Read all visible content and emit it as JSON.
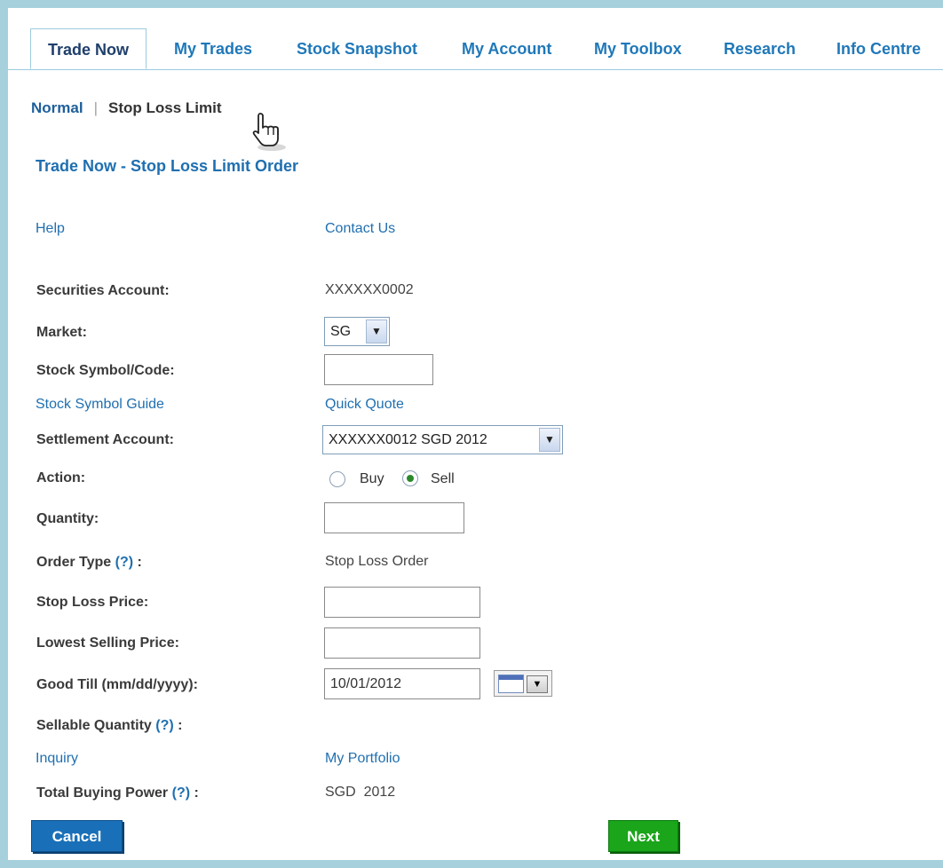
{
  "tabs": [
    {
      "label": "Trade Now",
      "active": true
    },
    {
      "label": "My Trades"
    },
    {
      "label": "Stock Snapshot"
    },
    {
      "label": "My Account"
    },
    {
      "label": "My Toolbox"
    },
    {
      "label": "Research"
    },
    {
      "label": "Info Centre"
    }
  ],
  "subnav": {
    "normal": "Normal",
    "separator": "|",
    "stop_loss_limit": "Stop Loss Limit"
  },
  "page_title": "Trade Now - Stop Loss Limit Order",
  "links": {
    "help": "Help",
    "contact_us": "Contact Us",
    "stock_symbol_guide": "Stock Symbol Guide",
    "quick_quote": "Quick Quote",
    "inquiry": "Inquiry",
    "my_portfolio": "My Portfolio"
  },
  "form": {
    "securities_account_label": "Securities Account:",
    "securities_account_value": "XXXXXX0002",
    "market_label": "Market:",
    "market_value": "SG",
    "stock_symbol_label": "Stock Symbol/Code:",
    "stock_symbol_value": "",
    "settlement_account_label": "Settlement Account:",
    "settlement_account_value": "XXXXXX0012 SGD 2012",
    "action_label": "Action:",
    "action_buy": "Buy",
    "action_sell": "Sell",
    "action_selected": "Sell",
    "quantity_label": "Quantity:",
    "quantity_value": "",
    "order_type_label": "Order Type",
    "help_marker": "(?)",
    "colon": ":",
    "order_type_value": "Stop Loss Order",
    "stop_loss_price_label": "Stop Loss Price:",
    "lowest_selling_price_label": "Lowest Selling Price:",
    "good_till_label": "Good Till (mm/dd/yyyy):",
    "good_till_value": "10/01/2012",
    "sellable_quantity_label": "Sellable Quantity",
    "total_buying_power_label": "Total Buying Power",
    "total_buying_power_value": "SGD  2012"
  },
  "buttons": {
    "cancel": "Cancel",
    "next": "Next"
  },
  "icons": [
    "hand-cursor-icon",
    "calendar-icon",
    "chevron-down-icon"
  ],
  "colors": {
    "link": "#1f6fb0",
    "frame": "#a6d1dc",
    "cancel": "#1a70b8",
    "next": "#1aa51a"
  }
}
